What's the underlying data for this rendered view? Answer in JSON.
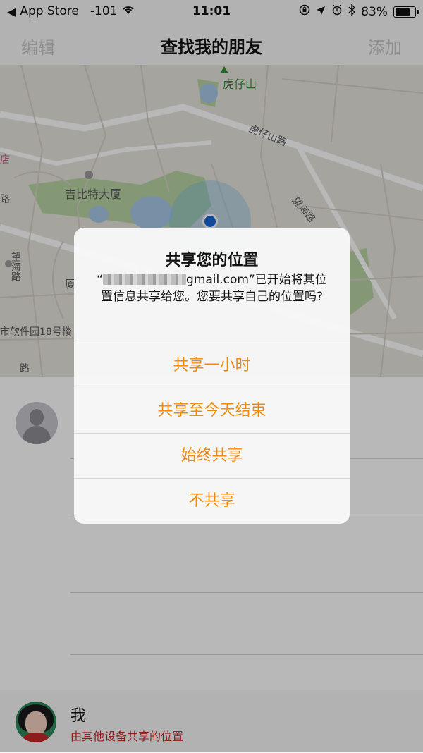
{
  "status_bar": {
    "back_app": "App Store",
    "signal": "-101",
    "time": "11:01",
    "battery": "83%"
  },
  "nav": {
    "left": "编辑",
    "title": "查找我的朋友",
    "right": "添加"
  },
  "map": {
    "labels": {
      "hill": "虎仔山",
      "road1": "虎仔山路",
      "building": "吉比特大厦",
      "road2": "望海路",
      "road3": "望海路",
      "software_park": "市软件园18号楼",
      "store": "店",
      "road_fragment": "路",
      "xia": "厦",
      "road_fragment2": "路"
    }
  },
  "alert": {
    "title": "共享您的位置",
    "message_after_redaction": "gmail.com”已开始将其位置信息共享给您。您要共享自己的位置吗?",
    "message_prefix": "“",
    "buttons": {
      "one_hour": "共享一小时",
      "end_of_day": "共享至今天结束",
      "always": "始终共享",
      "dont_share": "不共享"
    }
  },
  "me": {
    "name": "我",
    "subtitle": "由其他设备共享的位置"
  },
  "colors": {
    "accent_orange": "#f08a0a",
    "me_subtitle_red": "#c62828"
  },
  "icons": [
    "back-chevron-icon",
    "wifi-icon",
    "lock-rotation-icon",
    "location-arrow-icon",
    "alarm-icon",
    "bluetooth-icon",
    "battery-icon",
    "location-dot-icon",
    "person-placeholder-icon"
  ]
}
